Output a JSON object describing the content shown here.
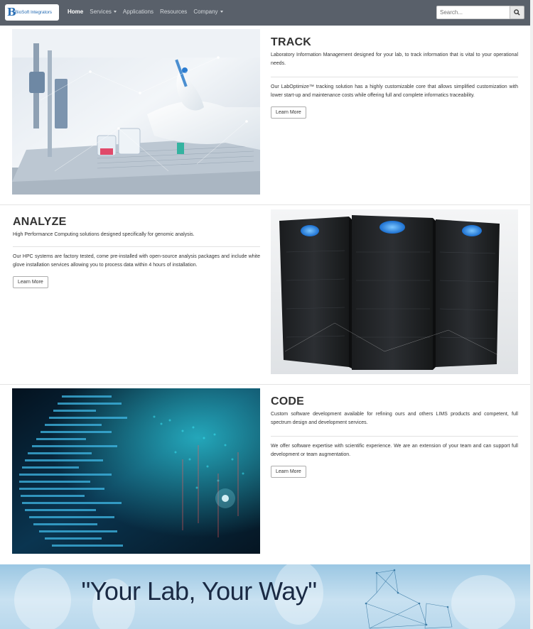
{
  "brand": {
    "name": "BioSoft Integrators"
  },
  "nav": {
    "items": [
      {
        "label": "Home",
        "active": true,
        "dropdown": false
      },
      {
        "label": "Services",
        "active": false,
        "dropdown": true
      },
      {
        "label": "Applications",
        "active": false,
        "dropdown": false
      },
      {
        "label": "Resources",
        "active": false,
        "dropdown": false
      },
      {
        "label": "Company",
        "active": false,
        "dropdown": true
      }
    ]
  },
  "search": {
    "placeholder": "Search...",
    "button_icon": "search-icon"
  },
  "sections": [
    {
      "title": "TRACK",
      "lead": "Laboratory Information Management designed for your lab, to track information that is vital to your operational needs.",
      "body": "Our LabOptimize™ tracking solution has a highly customizable core that allows simplified customization with lower start-up and maintenance costs while offering full and complete informatics traceability.",
      "button_label": "Learn More"
    },
    {
      "title": "ANALYZE",
      "lead": "High Performance Computing solutions designed specifically for genomic analysis.",
      "body": "Our HPC systems are factory tested, come pre-installed with open-source analysis packages and include white glove installation services allowing you to process data within 4 hours of installation.",
      "button_label": "Learn More"
    },
    {
      "title": "CODE",
      "lead": "Custom software development available for refining ours and others LIMS products and competent, full spectrum design and development services.",
      "body": "We offer software expertise with scientific experience. We are an extension of your team and can support full development or team augmentation.",
      "button_label": "Learn More"
    }
  ],
  "banner": {
    "quote": "\"Your Lab, Your Way\""
  },
  "colors": {
    "navbar": "#59606a",
    "brand_blue": "#2a6fb5",
    "banner": "#b9d8ec"
  }
}
